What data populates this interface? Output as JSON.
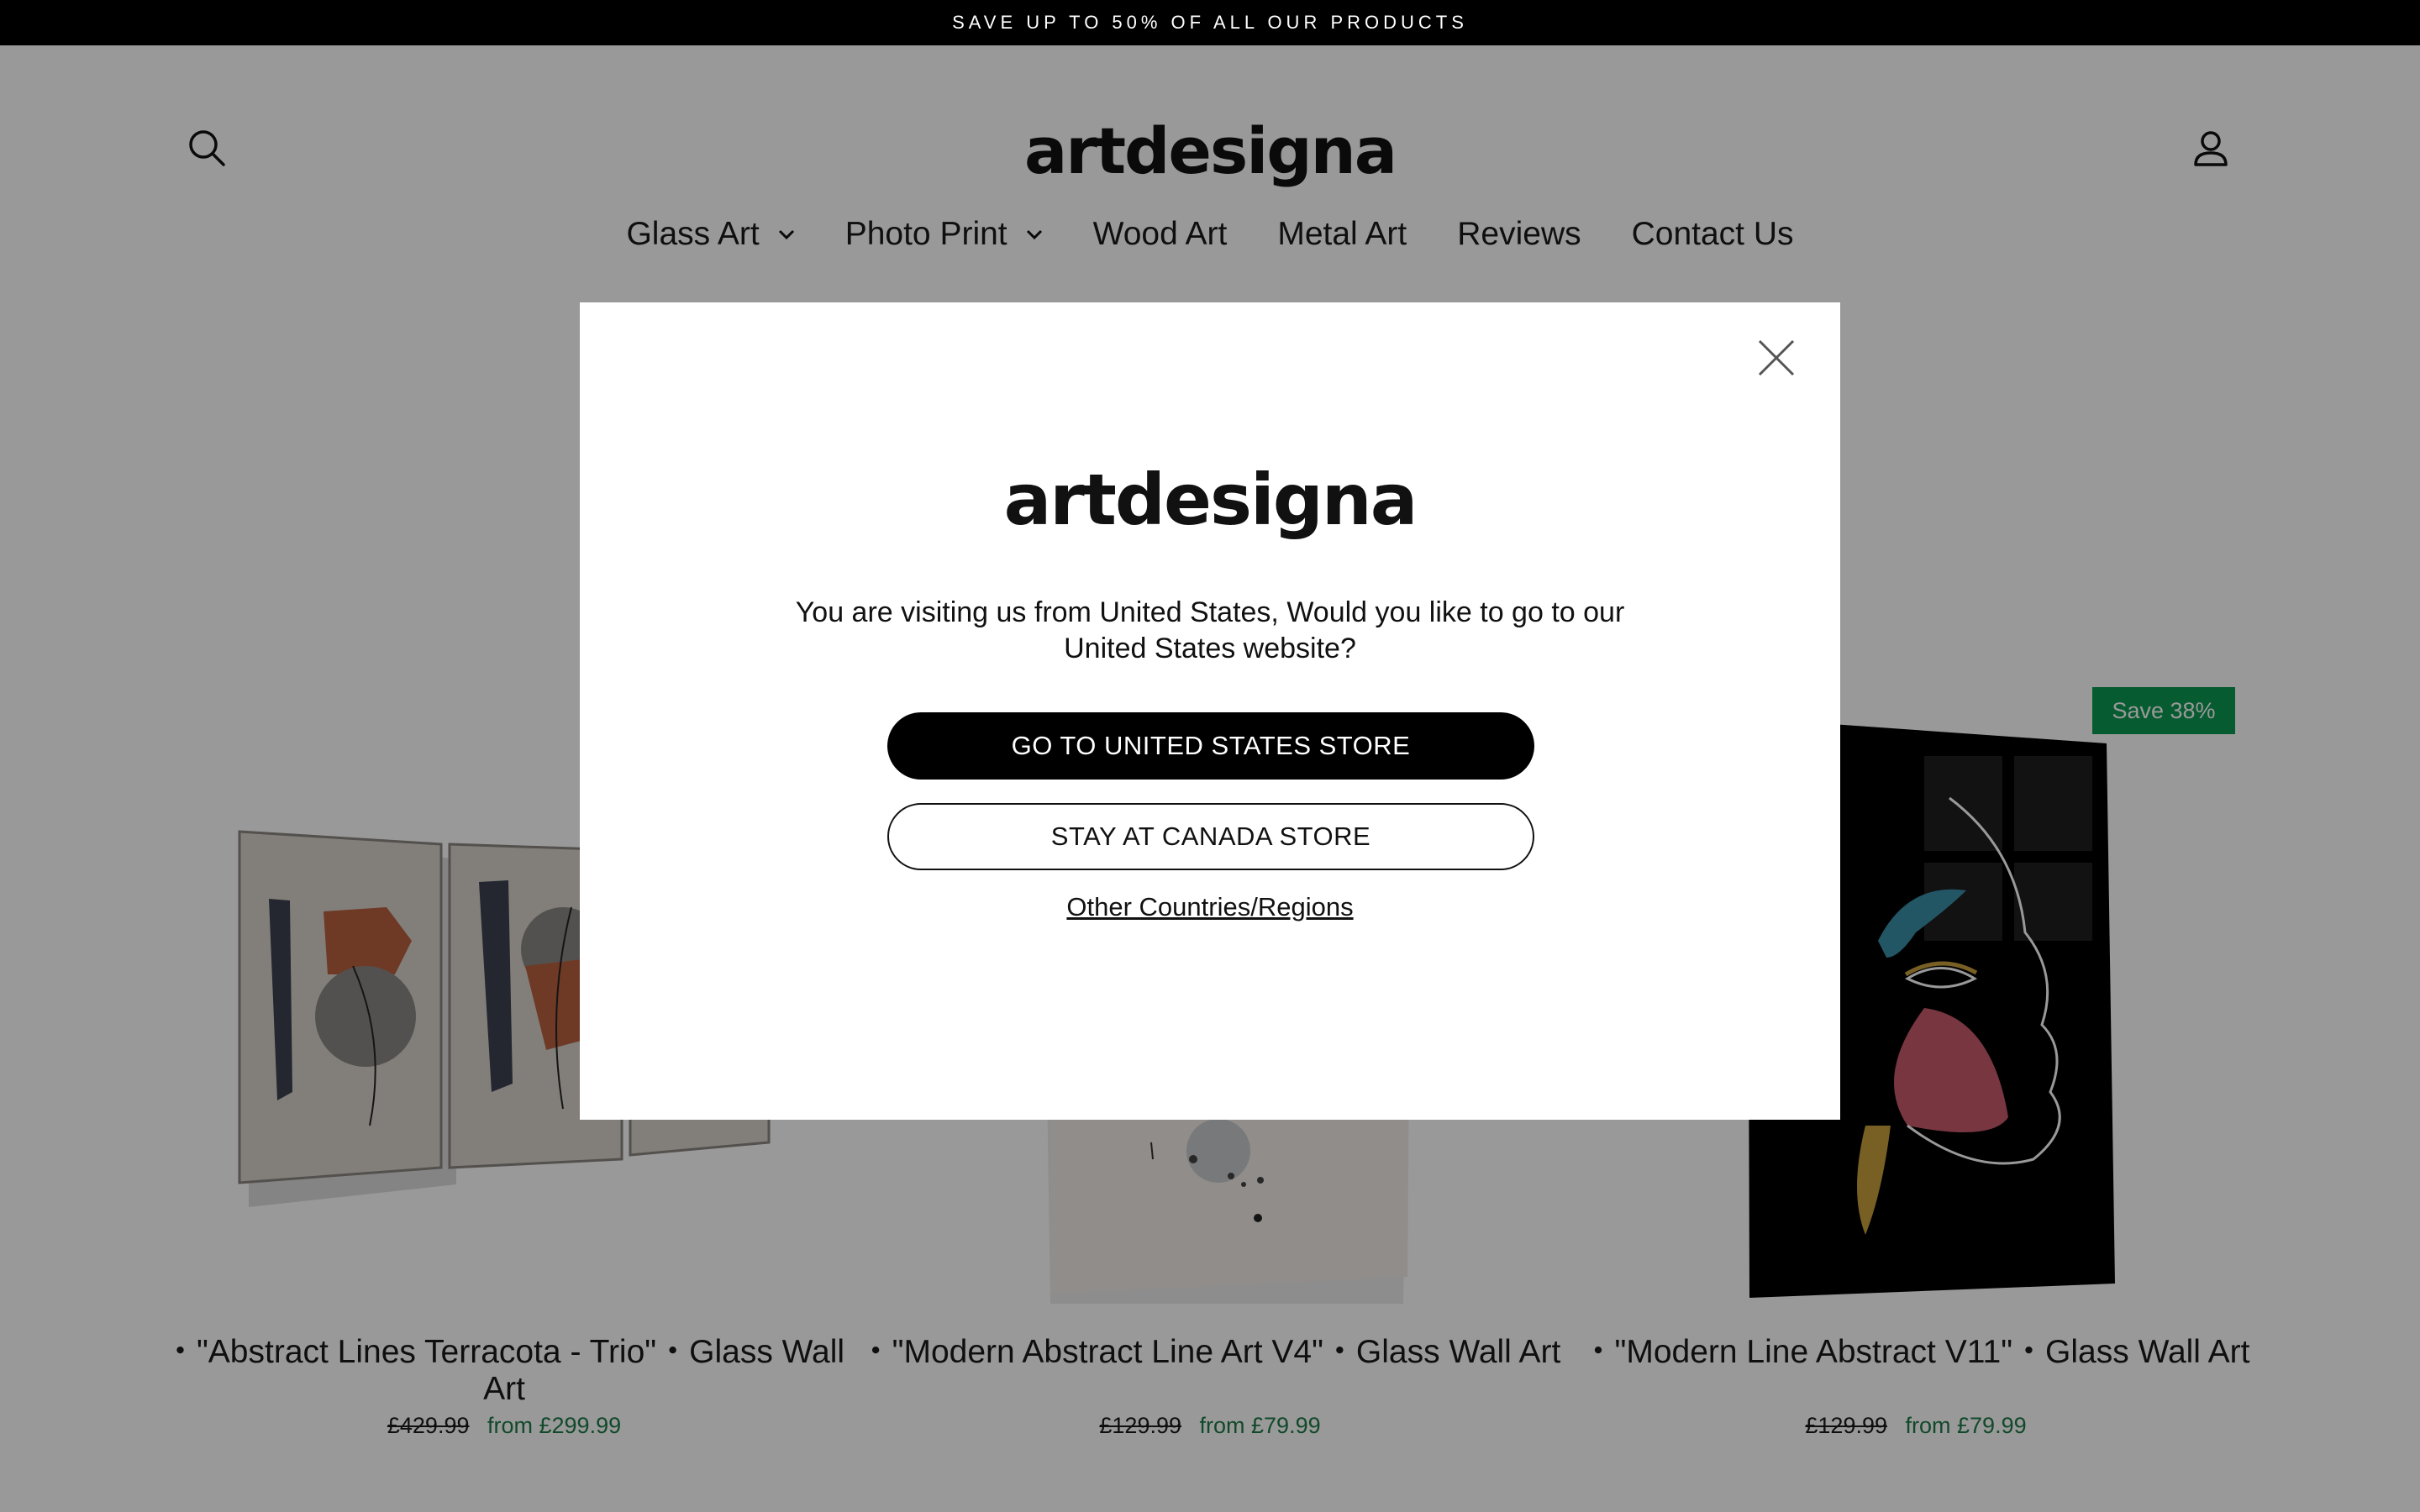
{
  "announcement": {
    "text": "SAVE UP TO 50% OF ALL OUR PRODUCTS"
  },
  "header": {
    "logo_text": "artdesigna",
    "search_icon": "search-icon",
    "account_icon": "user-icon",
    "nav": [
      {
        "label": "Glass Art",
        "has_dropdown": true
      },
      {
        "label": "Photo Print",
        "has_dropdown": true
      },
      {
        "label": "Wood Art",
        "has_dropdown": false
      },
      {
        "label": "Metal Art",
        "has_dropdown": false
      },
      {
        "label": "Reviews",
        "has_dropdown": false
      },
      {
        "label": "Contact Us",
        "has_dropdown": false
      }
    ]
  },
  "products": [
    {
      "title": "・\"Abstract Lines Terracota - Trio\"・Glass Wall Art",
      "old_price": "£429.99",
      "new_price": "from £299.99",
      "badge": ""
    },
    {
      "title": "・\"Modern Abstract Line Art V4\"・Glass Wall Art",
      "old_price": "£129.99",
      "new_price": "from £79.99",
      "badge": ""
    },
    {
      "title": "・\"Modern Line Abstract V11\"・Glass Wall Art",
      "old_price": "£129.99",
      "new_price": "from £79.99",
      "badge": "Save 38%"
    }
  ],
  "modal": {
    "logo_text": "artdesigna",
    "message": "You are visiting us from United States, Would you like to go to our United States website?",
    "primary_button": "GO TO UNITED STATES STORE",
    "secondary_button": "STAY AT CANADA STORE",
    "other_link": "Other Countries/Regions",
    "close_icon": "close-icon"
  },
  "colors": {
    "announcement_bg": "#000000",
    "sale_price": "#1f7a47",
    "badge_bg": "#0a9850",
    "primary_button_bg": "#000000"
  }
}
